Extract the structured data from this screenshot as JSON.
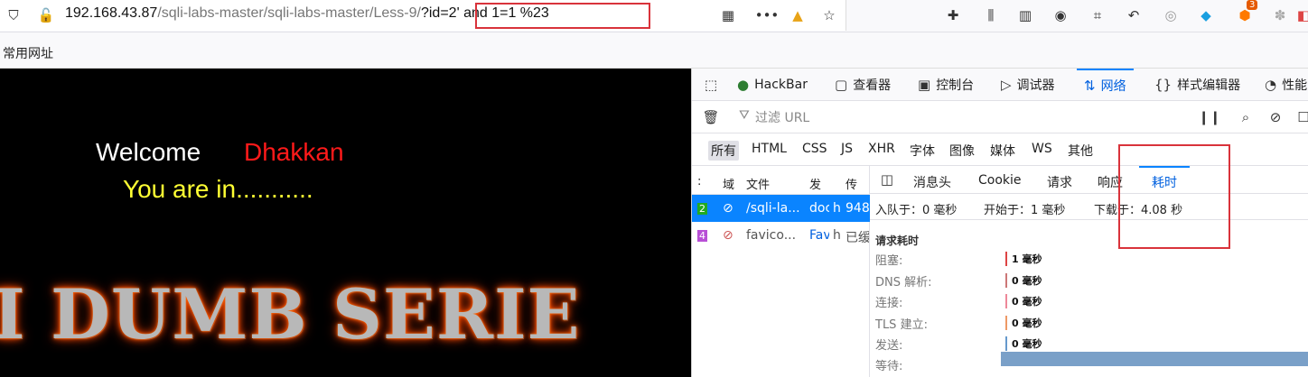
{
  "browser": {
    "url_host": "192.168.43.87",
    "url_path": "/sqli-labs-master/sqli-labs-master/Less-9/",
    "url_query": "?id=2' and 1=1 %23",
    "bookmark": "常用网址",
    "ext_badge": "3"
  },
  "page": {
    "welcome": "Welcome",
    "name": "Dhakkan",
    "status": "You are in...........",
    "banner": "I DUMB SERIE"
  },
  "devtools": {
    "tabs": [
      "HackBar",
      "查看器",
      "控制台",
      "调试器",
      "网络",
      "样式编辑器",
      "性能"
    ],
    "filter_placeholder": "过滤 URL",
    "types": [
      "所有",
      "HTML",
      "CSS",
      "JS",
      "XHR",
      "字体",
      "图像",
      "媒体",
      "WS",
      "其他"
    ],
    "list_headers": [
      ":",
      "域",
      "文件",
      "发",
      "传"
    ],
    "rows": [
      {
        "status": "2",
        "file": "/sqli-la...",
        "initiator": "doc",
        "type": "h",
        "size": "948"
      },
      {
        "status": "4",
        "file": "favico...",
        "initiator": "Fav",
        "type": "h",
        "size": "已缓"
      }
    ],
    "detail_tabs": [
      "消息头",
      "Cookie",
      "请求",
      "响应",
      "耗时"
    ],
    "summary": {
      "queued": "入队于：0 毫秒",
      "started": "开始于：1 毫秒",
      "downloaded": "下载于：4.08 秒"
    },
    "timings_title": "请求耗时",
    "timings": [
      {
        "label": "阻塞:",
        "value": "1 毫秒"
      },
      {
        "label": "DNS 解析:",
        "value": "0 毫秒"
      },
      {
        "label": "连接:",
        "value": "0 毫秒"
      },
      {
        "label": "TLS 建立:",
        "value": "0 毫秒"
      },
      {
        "label": "发送:",
        "value": "0 毫秒"
      },
      {
        "label": "等待:",
        "value": ""
      }
    ]
  }
}
